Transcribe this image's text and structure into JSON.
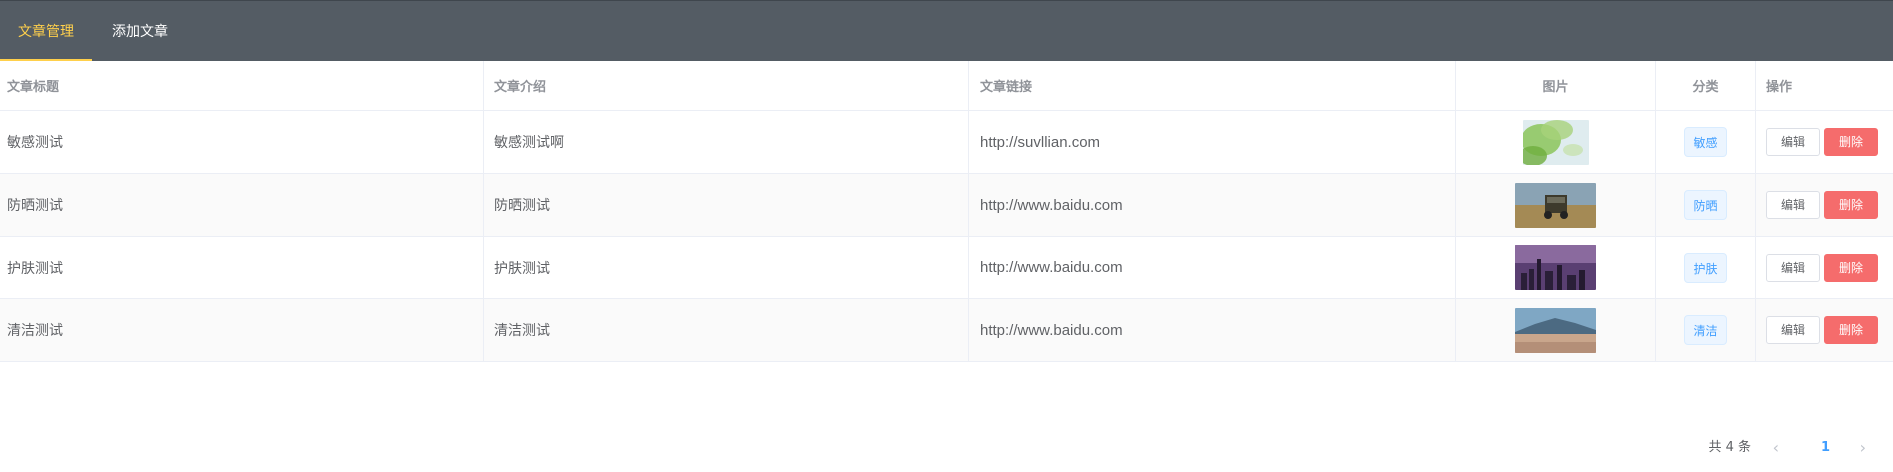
{
  "nav": {
    "tabs": [
      {
        "label": "文章管理",
        "active": true
      },
      {
        "label": "添加文章",
        "active": false
      }
    ]
  },
  "table": {
    "headers": {
      "title": "文章标题",
      "intro": "文章介绍",
      "link": "文章链接",
      "image": "图片",
      "category": "分类",
      "actions": "操作"
    },
    "rows": [
      {
        "title": "敏感测试",
        "intro": "敏感测试啊",
        "link": "http://suvllian.com",
        "category": "敏感",
        "edit": "编辑",
        "delete": "删除"
      },
      {
        "title": "防晒测试",
        "intro": "防晒测试",
        "link": "http://www.baidu.com",
        "category": "防晒",
        "edit": "编辑",
        "delete": "删除"
      },
      {
        "title": "护肤测试",
        "intro": "护肤测试",
        "link": "http://www.baidu.com",
        "category": "护肤",
        "edit": "编辑",
        "delete": "删除"
      },
      {
        "title": "清洁测试",
        "intro": "清洁测试",
        "link": "http://www.baidu.com",
        "category": "清洁",
        "edit": "编辑",
        "delete": "删除"
      }
    ]
  },
  "pagination": {
    "total": "共 4 条",
    "current_page": "1",
    "prev_icon": "chevron-left-icon",
    "next_icon": "chevron-right-icon"
  },
  "colors": {
    "nav_bg": "#545c64",
    "nav_active": "#ffd04b",
    "accent": "#409eff",
    "danger": "#f56c6c"
  }
}
